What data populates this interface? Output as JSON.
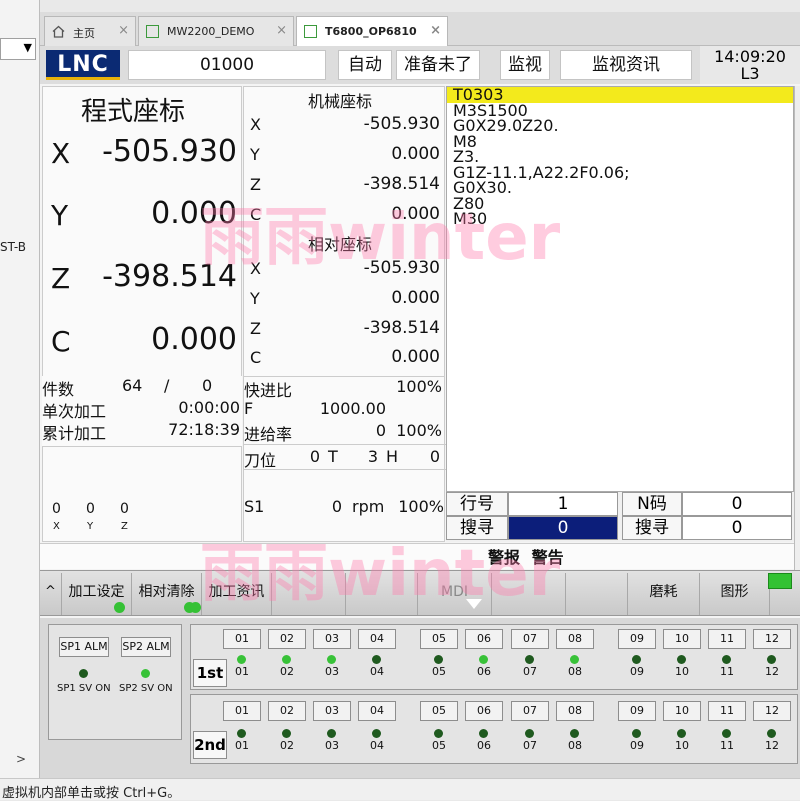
{
  "host": {
    "combo_arrow": "▼",
    "side_text": "ST-B",
    "scroll_arrow": ">",
    "status_text": "虚拟机内部单击或按 Ctrl+G。"
  },
  "tabs": [
    {
      "label": "主页",
      "close": "×",
      "icon": "home-icon"
    },
    {
      "label": "MW2200_DEMO",
      "close": "×",
      "icon": "vm-icon"
    },
    {
      "label": "T6800_OP6810",
      "close": "×",
      "icon": "vm-icon"
    }
  ],
  "header": {
    "logo": "LNC",
    "program_no": "01000",
    "mode": "自动",
    "state": "准备未了",
    "screen": "监视",
    "screen_sub": "监视资讯",
    "time": "14:09:20",
    "level": "L3"
  },
  "program_coords": {
    "title": "程式座标",
    "axes": [
      {
        "name": "X",
        "value": "-505.930"
      },
      {
        "name": "Y",
        "value": "0.000"
      },
      {
        "name": "Z",
        "value": "-398.514"
      },
      {
        "name": "C",
        "value": "0.000"
      }
    ]
  },
  "machine_coords": {
    "title": "机械座标",
    "axes": [
      {
        "name": "X",
        "value": "-505.930"
      },
      {
        "name": "Y",
        "value": "0.000"
      },
      {
        "name": "Z",
        "value": "-398.514"
      },
      {
        "name": "C",
        "value": "0.000"
      }
    ]
  },
  "relative_coords": {
    "title": "相对座标",
    "axes": [
      {
        "name": "X",
        "value": "-505.930"
      },
      {
        "name": "Y",
        "value": "0.000"
      },
      {
        "name": "Z",
        "value": "-398.514"
      },
      {
        "name": "C",
        "value": "0.000"
      }
    ]
  },
  "nc_program": [
    "T0303",
    "M3S1500",
    "G0X29.0Z20.",
    "M8",
    "Z3.",
    "G1Z-11.1,A22.2F0.06;",
    "G0X30.",
    "Z80",
    "M30"
  ],
  "counters": {
    "parts_label": "件数",
    "parts_count": "64",
    "parts_sep": "/",
    "parts_target": "0",
    "single_label": "单次加工",
    "single_time": "0:00:00",
    "total_label": "累计加工",
    "total_time": "72:18:39"
  },
  "mini_axes": [
    {
      "value": "0",
      "name": "X"
    },
    {
      "value": "0",
      "name": "Y"
    },
    {
      "value": "0",
      "name": "Z"
    }
  ],
  "feed": {
    "rapid_label": "快进比",
    "rapid_value": "100%",
    "f_label": "F",
    "f_value": "1000.00",
    "feed_label": "进给率",
    "feed_value": "0",
    "feed_pct": "100%",
    "tool_label": "刀位",
    "tool_value": "0",
    "t_label": "T",
    "t_value": "3",
    "h_label": "H",
    "h_value": "0",
    "spindle_label": "S1",
    "spindle_value": "0",
    "spindle_unit": "rpm",
    "spindle_pct": "100%"
  },
  "search": {
    "line_label": "行号",
    "line_value": "1",
    "n_label": "N码",
    "n_value": "0",
    "search_label": "搜寻",
    "search_value": "0",
    "search_label_2": "搜寻",
    "search_value_2": "0"
  },
  "messages": {
    "alarm": "警报",
    "warning": "警告"
  },
  "softkeys": {
    "left_arrow": "^",
    "k1": "加工设定",
    "k2": "相对清除",
    "k3": "加工资讯",
    "k_mdi": "MDI",
    "k_wear": "磨耗",
    "k_graph": "图形"
  },
  "spindle_panel": {
    "sp1_alm": "SP1 ALM",
    "sp2_alm": "SP2 ALM",
    "sp1_sv": "SP1 SV ON",
    "sp2_sv": "SP2 SV ON"
  },
  "io_rows": [
    {
      "tag": "1st",
      "buttons": [
        "01",
        "02",
        "03",
        "04",
        "05",
        "06",
        "07",
        "08",
        "09",
        "10",
        "11",
        "12"
      ],
      "leds": [
        "on",
        "on",
        "on",
        "dark",
        "dark",
        "on",
        "dark",
        "on",
        "dark",
        "dark",
        "dark",
        "dark"
      ]
    },
    {
      "tag": "2nd",
      "buttons": [
        "01",
        "02",
        "03",
        "04",
        "05",
        "06",
        "07",
        "08",
        "09",
        "10",
        "11",
        "12"
      ],
      "leds": [
        "dark",
        "dark",
        "dark",
        "dark",
        "dark",
        "dark",
        "dark",
        "dark",
        "dark",
        "dark",
        "dark",
        "dark"
      ]
    }
  ],
  "watermark": "雨雨winter",
  "colors": {
    "highlight": "#f3ea1c",
    "search_select": "#0c1e7a",
    "led_on": "#38c238",
    "led_dark": "#1f5a1f",
    "logo_bg": "#0b2a73"
  }
}
